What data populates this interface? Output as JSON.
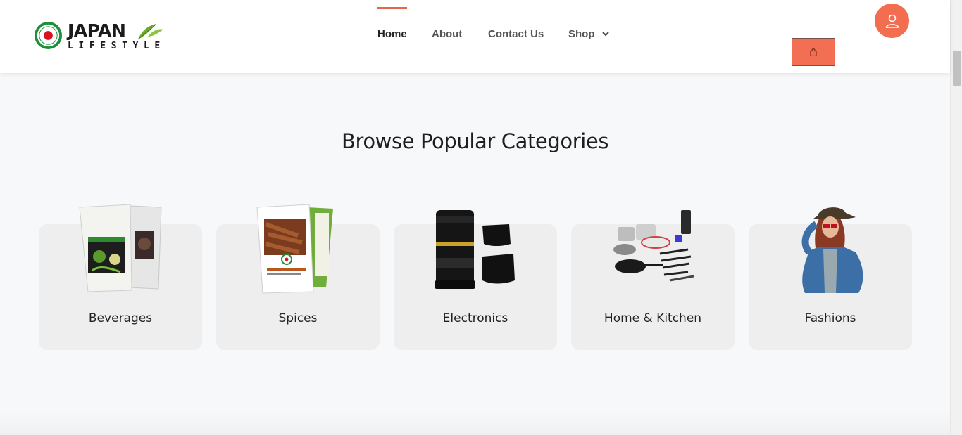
{
  "brand": {
    "name_top": "JAPAN",
    "name_bottom": "LIFESTYLE",
    "badge_text": "JAPAN LIFESTYLE"
  },
  "nav": {
    "items": [
      {
        "label": "Home"
      },
      {
        "label": "About"
      },
      {
        "label": "Contact Us"
      },
      {
        "label": "Shop"
      }
    ],
    "active_index": 0
  },
  "header": {
    "cart_icon": "shopping-bag-icon",
    "user_icon": "user-icon"
  },
  "section": {
    "title": "Browse Popular Categories"
  },
  "categories": [
    {
      "label": "Beverages",
      "icon": "tea-packets-image"
    },
    {
      "label": "Spices",
      "icon": "spice-packets-image"
    },
    {
      "label": "Electronics",
      "icon": "camera-lens-image"
    },
    {
      "label": "Home & Kitchen",
      "icon": "cookware-set-image"
    },
    {
      "label": "Fashions",
      "icon": "fashion-model-image"
    }
  ],
  "colors": {
    "accent": "#f26f53",
    "card_bg": "#eeeeee",
    "page_bg": "#f7f8fa"
  }
}
